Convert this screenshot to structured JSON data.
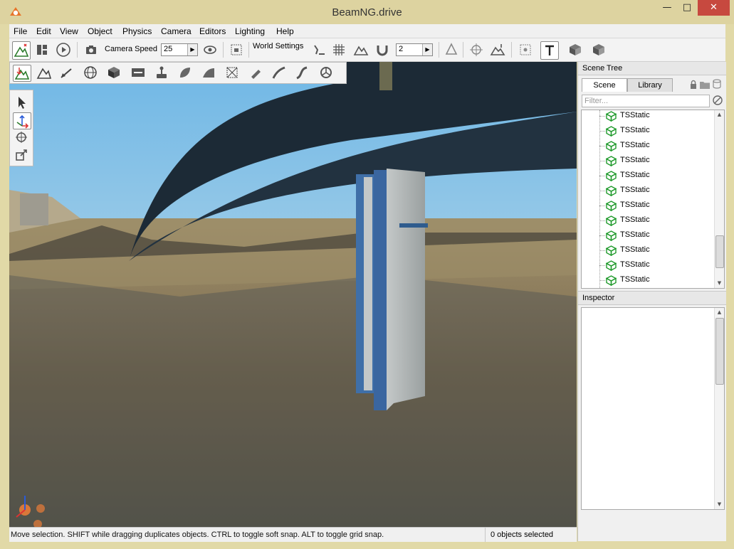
{
  "window": {
    "title": "BeamNG.drive",
    "close_glyph": "✕",
    "maximize_glyph": "□",
    "minimize_glyph": "—"
  },
  "menu": [
    "File",
    "Edit",
    "View",
    "Object",
    "Physics",
    "Camera",
    "Editors",
    "Lighting",
    "Help"
  ],
  "toolbar": {
    "camera_speed_label": "Camera Speed",
    "camera_speed_value": "25",
    "world_settings_label": "World Settings",
    "snap_value": "2"
  },
  "scene_tree": {
    "header": "Scene Tree",
    "tabs": [
      "Scene",
      "Library"
    ],
    "active_tab": "Scene",
    "filter_placeholder": "Filter...",
    "items": [
      "TSStatic",
      "TSStatic",
      "TSStatic",
      "TSStatic",
      "TSStatic",
      "TSStatic",
      "TSStatic",
      "TSStatic",
      "TSStatic",
      "TSStatic",
      "TSStatic",
      "TSStatic"
    ]
  },
  "inspector": {
    "header": "Inspector"
  },
  "status": {
    "hint": "Move selection.  SHIFT while dragging duplicates objects.  CTRL to toggle soft snap.  ALT to toggle grid snap.",
    "selection": "0 objects selected"
  },
  "colors": {
    "sky": "#8fc6e6",
    "ground": "#8a7655",
    "bridge": "#1c2a36",
    "pillar": "#aeb3b3",
    "pillar_accent": "#3f6fa8",
    "close_button": "#c7493f",
    "object_icon": "#1f9a2b"
  }
}
